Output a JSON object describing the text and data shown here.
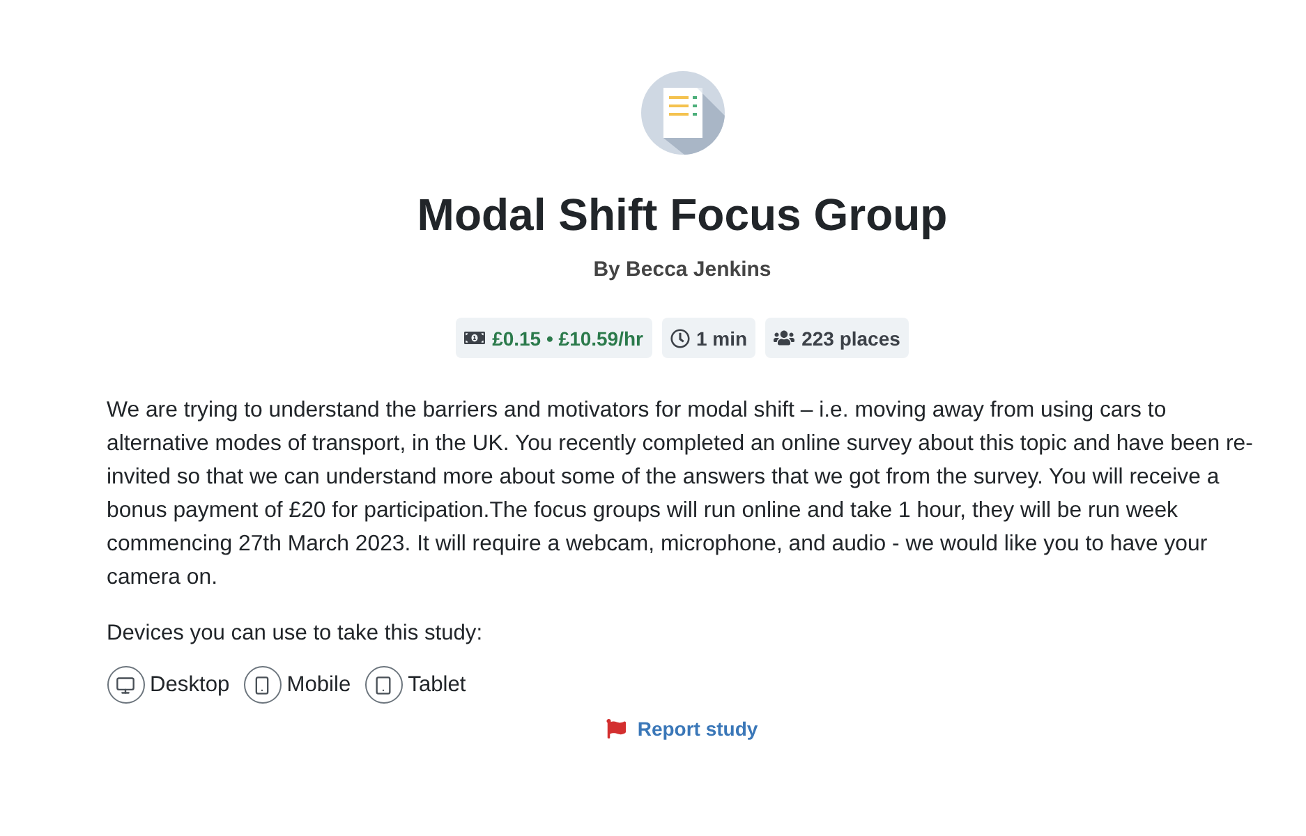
{
  "header": {
    "title": "Modal Shift Focus Group",
    "author": "By Becca Jenkins"
  },
  "badges": [
    {
      "kind": "reward",
      "text": "£0.15 • £10.59/hr"
    },
    {
      "kind": "time",
      "text": "1 min"
    },
    {
      "kind": "places",
      "text": "223 places"
    }
  ],
  "description": "We are trying to understand the barriers and motivators for modal shift – i.e. moving away from using cars to alternative modes of transport, in the UK. You recently completed an online survey about this topic and have been re-invited so that we can understand more about some of the answers that we got from the survey. You will receive a bonus payment of £20 for participation.The focus groups will run online and take 1 hour, they will be run week commencing 27th March 2023. It will require a webcam, microphone, and audio - we would like you to have your camera on.",
  "devices": {
    "label": "Devices you can use to take this study:",
    "items": [
      {
        "kind": "desktop",
        "label": "Desktop"
      },
      {
        "kind": "mobile",
        "label": "Mobile"
      },
      {
        "kind": "tablet",
        "label": "Tablet"
      }
    ]
  },
  "report_link": "Report study"
}
